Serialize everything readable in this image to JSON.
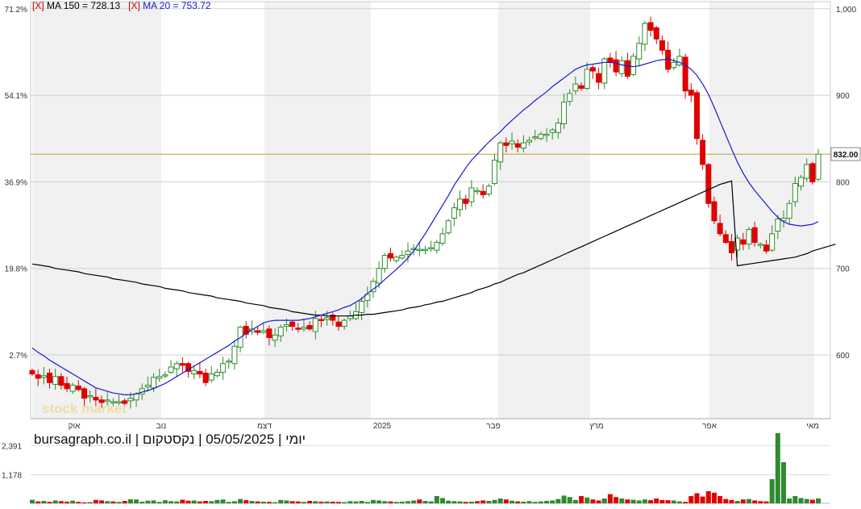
{
  "legend": {
    "ma150": {
      "close": "[X]",
      "label": "MA 150 = 728.13"
    },
    "ma20": {
      "close": "[X]",
      "label": "MA 20 = 753.72"
    }
  },
  "footer": "יומי | 05/05/2025 | נקסטקום | bursagraph.co.il",
  "watermark": "stock market",
  "last_price_label": "832.00",
  "colors": {
    "up": "#2e8b2e",
    "down": "#e00000",
    "ma20": "#1a1ad6",
    "ma150": "#000000",
    "price_line": "#c8963c",
    "band": "#f1f1f1"
  },
  "chart_data": {
    "type": "candlestick",
    "price_axis_right": {
      "ticks": [
        600,
        700,
        800,
        900,
        1000
      ],
      "labels": [
        "600",
        "700",
        "800",
        "900",
        "1,000"
      ],
      "ylim": [
        525,
        1006
      ]
    },
    "percent_axis_left": {
      "labels": [
        "2.7%",
        "19.8%",
        "36.9%",
        "54.1%",
        "71.2%"
      ],
      "at_price": [
        600,
        700,
        800,
        900,
        1000
      ]
    },
    "x_labels": [
      "אוק",
      "נוב",
      "דצמ",
      "2025",
      "פבר",
      "מרץ",
      "אפר",
      "מאי"
    ],
    "last_price": 832,
    "close": [
      578,
      573,
      576,
      568,
      575,
      565,
      561,
      565,
      560,
      550,
      553,
      548,
      545,
      548,
      546,
      546,
      544,
      550,
      555,
      561,
      565,
      574,
      575,
      577,
      586,
      590,
      588,
      581,
      582,
      578,
      568,
      578,
      580,
      590,
      593,
      610,
      632,
      624,
      630,
      626,
      628,
      620,
      623,
      632,
      635,
      633,
      630,
      632,
      630,
      642,
      640,
      643,
      640,
      633,
      640,
      645,
      650,
      662,
      670,
      685,
      700,
      715,
      712,
      713,
      715,
      720,
      723,
      722,
      722,
      724,
      730,
      740,
      755,
      770,
      780,
      775,
      793,
      790,
      785,
      795,
      825,
      845,
      842,
      847,
      840,
      845,
      848,
      852,
      855,
      855,
      860,
      868,
      892,
      902,
      913,
      908,
      930,
      928,
      915,
      942,
      938,
      927,
      940,
      922,
      945,
      960,
      983,
      975,
      965,
      952,
      930,
      938,
      945,
      905,
      900,
      850,
      820,
      775,
      755,
      740,
      730,
      718,
      735,
      728,
      745,
      730,
      728,
      720,
      740,
      757,
      758,
      775,
      798,
      805,
      820,
      800,
      832
    ],
    "ma20": [
      608,
      603,
      599,
      594,
      590,
      586,
      582,
      578,
      574,
      570,
      566,
      562,
      560,
      558,
      556,
      555,
      554,
      554,
      555,
      557,
      559,
      561,
      564,
      567,
      571,
      575,
      579,
      583,
      587,
      591,
      595,
      599,
      603,
      607,
      611,
      616,
      620,
      625,
      629,
      633,
      637,
      639,
      640,
      640,
      640,
      640,
      640,
      641,
      642,
      644,
      646,
      648,
      650,
      652,
      655,
      657,
      661,
      665,
      671,
      676,
      681,
      687,
      693,
      699,
      705,
      712,
      720,
      730,
      740,
      751,
      762,
      773,
      784,
      796,
      806,
      816,
      825,
      832,
      839,
      846,
      852,
      858,
      865,
      871,
      877,
      883,
      888,
      894,
      899,
      904,
      910,
      915,
      920,
      925,
      930,
      933,
      935,
      936,
      937,
      938,
      938,
      937,
      935,
      934,
      933,
      934,
      936,
      938,
      940,
      941,
      942,
      940,
      938,
      935,
      930,
      923,
      913,
      901,
      886,
      870,
      854,
      838,
      823,
      810,
      799,
      790,
      782,
      774,
      766,
      759,
      754,
      751,
      750,
      749,
      750,
      751,
      754
    ],
    "ma150": [
      705,
      704,
      703,
      702,
      700,
      699,
      698,
      697,
      696,
      694,
      693,
      692,
      691,
      690,
      688,
      687,
      686,
      685,
      684,
      682,
      681,
      680,
      679,
      677,
      676,
      675,
      674,
      672,
      671,
      670,
      669,
      668,
      666,
      665,
      664,
      663,
      662,
      660,
      659,
      658,
      657,
      655,
      654,
      653,
      652,
      650,
      649,
      648,
      647,
      646,
      646,
      645,
      645,
      645,
      645,
      645,
      646,
      646,
      647,
      647,
      648,
      649,
      650,
      651,
      652,
      654,
      655,
      656,
      658,
      659,
      661,
      662,
      664,
      666,
      668,
      670,
      672,
      675,
      677,
      679,
      682,
      684,
      687,
      690,
      693,
      695,
      698,
      701,
      704,
      707,
      710,
      713,
      716,
      719,
      722,
      725,
      728,
      731,
      734,
      737,
      740,
      743,
      746,
      749,
      752,
      755,
      758,
      761,
      764,
      767,
      770,
      773,
      776,
      779,
      782,
      785,
      788,
      791,
      794,
      797,
      799,
      801,
      703,
      704,
      705,
      706,
      707,
      708,
      709,
      710,
      711,
      712,
      713,
      715,
      717,
      720,
      722,
      724,
      726,
      728
    ],
    "volume_axis": {
      "labels": [
        "1,178",
        "2,391"
      ],
      "values": [
        1178,
        2391
      ]
    },
    "volume": [
      150,
      80,
      100,
      60,
      120,
      90,
      70,
      110,
      60,
      40,
      50,
      140,
      120,
      90,
      80,
      60,
      100,
      170,
      160,
      70,
      110,
      120,
      60,
      130,
      90,
      80,
      150,
      110,
      120,
      80,
      100,
      90,
      140,
      160,
      60,
      90,
      180,
      130,
      100,
      80,
      70,
      60,
      50,
      140,
      120,
      90,
      80,
      60,
      100,
      90,
      70,
      80,
      70,
      60,
      50,
      90,
      80,
      100,
      60,
      140,
      120,
      90,
      80,
      60,
      70,
      90,
      120,
      160,
      100,
      80,
      300,
      220,
      110,
      90,
      80,
      60,
      70,
      90,
      120,
      100,
      140,
      200,
      160,
      110,
      80,
      70,
      90,
      60,
      80,
      100,
      120,
      180,
      320,
      260,
      140,
      300,
      240,
      160,
      120,
      200,
      380,
      260,
      200,
      160,
      150,
      120,
      160,
      130,
      200,
      140,
      130,
      120,
      80,
      60,
      300,
      420,
      280,
      500,
      440,
      300,
      180,
      140,
      100,
      160,
      180,
      120,
      90,
      80,
      1000,
      2900,
      1700,
      200,
      300,
      220,
      180,
      150,
      200
    ]
  }
}
